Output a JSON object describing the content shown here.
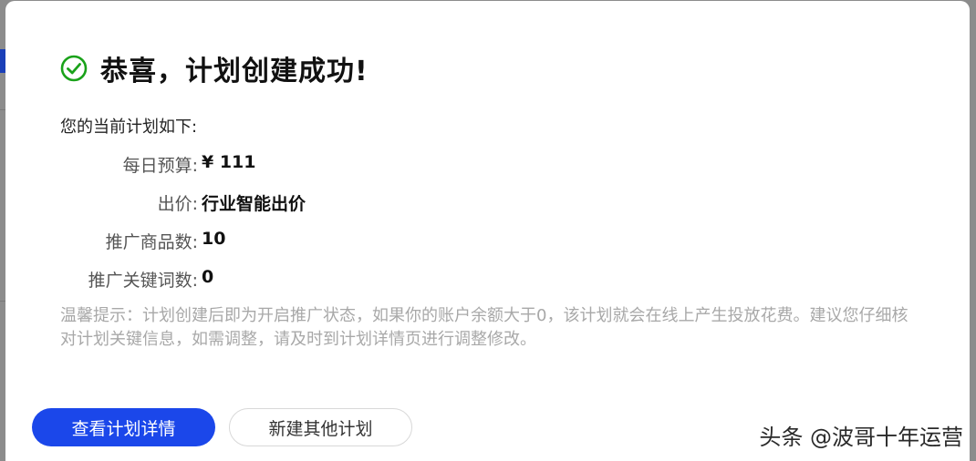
{
  "dialog": {
    "icon": "check-circle-icon",
    "title": "恭喜，计划创建成功!",
    "intro": "您的当前计划如下:",
    "fields": [
      {
        "label": "每日预算:",
        "value": "¥ 111"
      },
      {
        "label": "出价:",
        "value": "行业智能出价"
      },
      {
        "label": "推广商品数:",
        "value": "10"
      },
      {
        "label": "推广关键词数:",
        "value": "0"
      }
    ],
    "tip": "温馨提示：计划创建后即为开启推广状态，如果你的账户余额大于0，该计划就会在线上产生投放花费。建议您仔细核对计划关键信息，如需调整，请及时到计划详情页进行调整修改。",
    "primary_button": "查看计划详情",
    "secondary_button": "新建其他计划"
  },
  "watermark": "头条 @波哥十年运营",
  "colors": {
    "accent": "#1b47ea",
    "success": "#1aa21a"
  }
}
